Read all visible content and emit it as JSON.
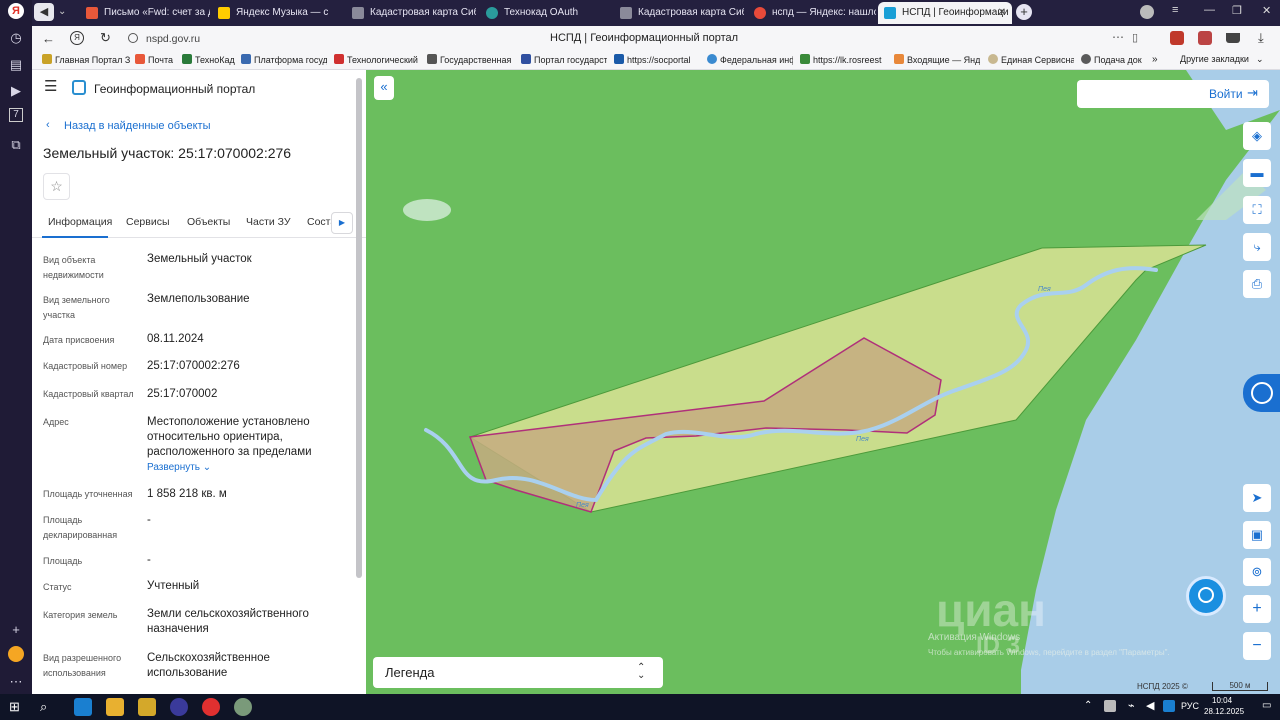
{
  "browser": {
    "tabs": [
      {
        "label": "Письмо «Fwd: счет за де",
        "color": "#e8583a"
      },
      {
        "label": "Яндекс Музыка — с",
        "color": "#ffcc00"
      },
      {
        "label": "Кадастровая карта Сиби",
        "color": "#8a8a9a"
      },
      {
        "label": "Технокад OAuth",
        "color": "#2a9c9c"
      },
      {
        "label": "Кадастровая карта Сиби",
        "color": "#8a8a9a"
      },
      {
        "label": "нспд — Яндекс: нашлось",
        "color": "#e84a3a"
      },
      {
        "label": "НСПД | Геоинформаци",
        "color": "#1a9fd6"
      }
    ],
    "address": "nspd.gov.ru",
    "page_title": "НСПД | Геоинформационный портал",
    "bookmarks": [
      {
        "label": "Главная Портал З",
        "color": "#c9a227"
      },
      {
        "label": "Почта",
        "color": "#e8583a"
      },
      {
        "label": "ТехноКад",
        "color": "#2a7a3a"
      },
      {
        "label": "Платформа госуд",
        "color": "#3a6ab0"
      },
      {
        "label": "Технологический",
        "color": "#d03030"
      },
      {
        "label": "Государственная",
        "color": "#555"
      },
      {
        "label": "Портал государст",
        "color": "#3050a0"
      },
      {
        "label": "https://socportal",
        "color": "#1a5aa8"
      },
      {
        "label": "Федеральная инф",
        "color": "#3a8ad0"
      },
      {
        "label": "https://lk.rosreest",
        "color": "#3a8a3a"
      },
      {
        "label": "Входящие — Янд",
        "color": "#e8883a"
      },
      {
        "label": "Единая Сервисна",
        "color": "#c8b890"
      },
      {
        "label": "Подача док",
        "color": "#5a5a5a"
      }
    ],
    "other_bookmarks": "Другие закладки"
  },
  "panel": {
    "portal_title": "Геоинформационный портал",
    "back_link": "Назад в найденные объекты",
    "object_title": "Земельный участок: 25:17:070002:276",
    "tabs": [
      "Информация",
      "Сервисы",
      "Объекты",
      "Части ЗУ",
      "Соста"
    ],
    "fields": [
      {
        "label": "Вид объекта недвижимости",
        "value": "Земельный участок"
      },
      {
        "label": "Вид земельного участка",
        "value": "Землепользование"
      },
      {
        "label": "Дата присвоения",
        "value": "08.11.2024"
      },
      {
        "label": "Кадастровый номер",
        "value": "25:17:070002:276"
      },
      {
        "label": "Кадастровый квартал",
        "value": "25:17:070002"
      },
      {
        "label": "Адрес",
        "value": "Местоположение установлено относительно ориентира, расположенного за пределами"
      },
      {
        "label": "Площадь уточненная",
        "value": "1 858 218 кв. м"
      },
      {
        "label": "Площадь декларированная",
        "value": "-"
      },
      {
        "label": "Площадь",
        "value": "-"
      },
      {
        "label": "Статус",
        "value": "Учтенный"
      },
      {
        "label": "Категория земель",
        "value": "Земли сельскохозяйственного назначения"
      },
      {
        "label": "Вид разрешенного использования",
        "value": "Сельскохозяйственное использование"
      }
    ],
    "expand": "Развернуть"
  },
  "map": {
    "login": "Войти",
    "legend": "Легенда",
    "river1": "Пея",
    "river2": "Пея",
    "river3": "Пея",
    "copyright": "НСПД 2025 ©",
    "scale": "500 м",
    "watermark": "циан",
    "watermark_id": "ID 3",
    "activation": "Активация Windows",
    "activation_sub": "Чтобы активировать Windows, перейдите в раздел \"Параметры\"."
  },
  "taskbar": {
    "time": "10:04",
    "date": "28.12.2025",
    "lang": "РУС"
  }
}
